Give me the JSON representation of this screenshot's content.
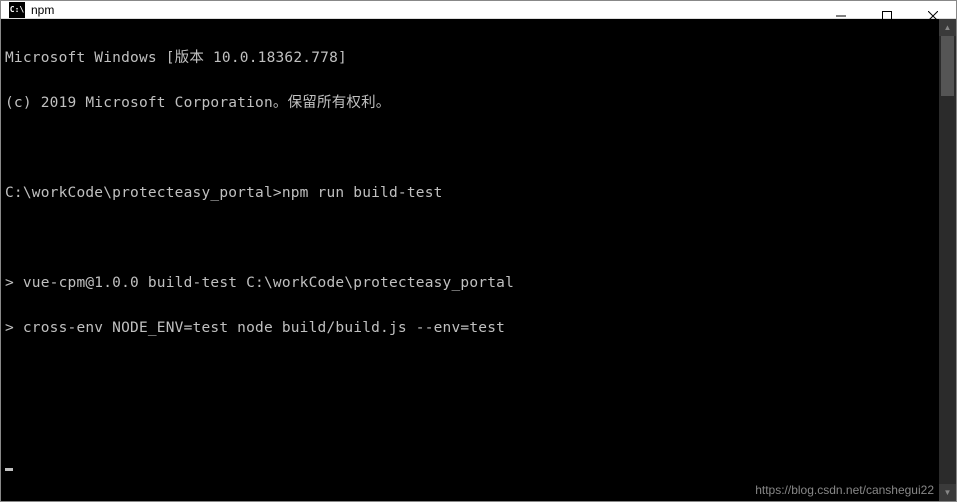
{
  "window": {
    "icon_text": "C:\\",
    "title": "npm"
  },
  "terminal": {
    "lines": [
      "Microsoft Windows [版本 10.0.18362.778]",
      "(c) 2019 Microsoft Corporation。保留所有权利。",
      "",
      "C:\\workCode\\protecteasy_portal>npm run build-test",
      "",
      "> vue-cpm@1.0.0 build-test C:\\workCode\\protecteasy_portal",
      "> cross-env NODE_ENV=test node build/build.js --env=test",
      "",
      ""
    ]
  },
  "watermark": "https://blog.csdn.net/canshegui22"
}
